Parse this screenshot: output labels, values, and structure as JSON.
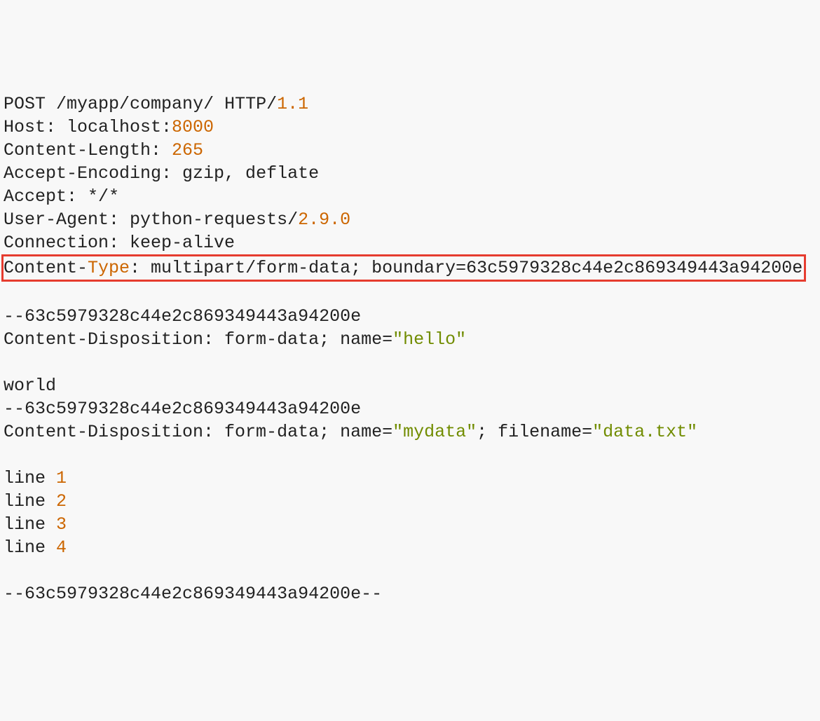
{
  "request": {
    "method": "POST",
    "path": "/myapp/company/",
    "http_label": "HTTP/",
    "http_version": "1.1",
    "headers": {
      "host_key": "Host: ",
      "host_prefix": "localhost:",
      "host_port": "8000",
      "content_length_key": "Content-Length: ",
      "content_length_value": "265",
      "accept_encoding_key": "Accept-Encoding: ",
      "accept_encoding_value": "gzip, deflate",
      "accept_key": "Accept: ",
      "accept_value": "*/*",
      "user_agent_key": "User-Agent: ",
      "user_agent_prefix": "python-requests/",
      "user_agent_version": "2.9.0",
      "connection_key": "Connection: ",
      "connection_value": "keep-alive",
      "content_type_prefix": "Content-",
      "content_type_word": "Type",
      "content_type_suffix": ": multipart/form-data; boundary=63c5979328c44e2c869349443a94200e"
    }
  },
  "body": {
    "boundary1": "--63c5979328c44e2c869349443a94200e",
    "cd1_prefix": "Content-Disposition: form-data; name=",
    "cd1_name": "\"hello\"",
    "part1_value": "world",
    "boundary2": "--63c5979328c44e2c869349443a94200e",
    "cd2_prefix": "Content-Disposition: form-data; name=",
    "cd2_name": "\"mydata\"",
    "cd2_middle": "; filename=",
    "cd2_filename": "\"data.txt\"",
    "file_lines": {
      "l1_prefix": "line ",
      "l1_num": "1",
      "l2_prefix": "line ",
      "l2_num": "2",
      "l3_prefix": "line ",
      "l3_num": "3",
      "l4_prefix": "line ",
      "l4_num": "4"
    },
    "boundary3": "--63c5979328c44e2c869349443a94200e--"
  }
}
